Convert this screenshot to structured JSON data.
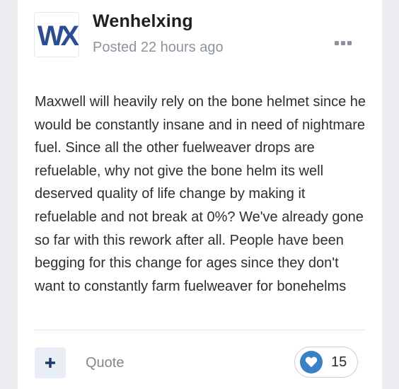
{
  "post": {
    "author": "Wenhelxing",
    "avatar_text": "WX",
    "posted_label": "Posted 22 hours ago",
    "body": "Maxwell will heavily rely on the bone helmet since he would be constantly insane and in need of nightmare fuel. Since all the other fuelweaver drops are refuelable, why not give the bone helm its well deserved quality of life change by making it refuelable and not break at 0%? We've already gone so far with this rework after all. People have been begging for this change for ages since they don't want to constantly farm fuelweaver for bonehelms"
  },
  "actions": {
    "plus_icon": "plus-icon",
    "quote_label": "Quote",
    "reaction_icon": "heart-icon",
    "reaction_count": "15"
  },
  "colors": {
    "accent": "#3a80c4",
    "avatar_blue": "#2d4d8f",
    "text": "#2f2f2f",
    "muted": "#8c939e"
  }
}
